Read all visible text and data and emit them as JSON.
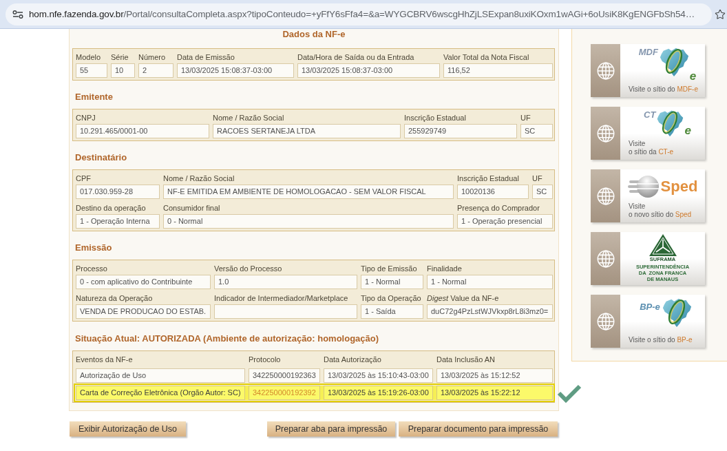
{
  "address_bar": {
    "host": "hom.nfe.fazenda.gov.br",
    "path": "/Portal/consultaCompleta.aspx?tipoConteudo=+yFfY6sFfa4=&a=WYGCBRV6wscgHhZjLSExpan8uxiKOxm1wAGi+6oUsiK8KgENGFbSh54…"
  },
  "title": "Dados da NF-e",
  "dados": [
    [
      {
        "label": "Modelo",
        "value": "55"
      },
      {
        "label": "Série",
        "value": "10"
      },
      {
        "label": "Número",
        "value": "2"
      },
      {
        "label": "Data de Emissão",
        "value": "13/03/2025 15:08:37-03:00"
      },
      {
        "label": "Data/Hora de Saída ou da Entrada",
        "value": "13/03/2025 15:08:37-03:00"
      },
      {
        "label": "Valor Total da Nota Fiscal",
        "value": "116,52"
      }
    ]
  ],
  "sections": [
    {
      "heading": "Emitente",
      "rows": [
        [
          {
            "label": "CNPJ",
            "value": "10.291.465/0001-00"
          },
          {
            "label": "Nome / Razão Social",
            "value": "RACOES SERTANEJA LTDA"
          },
          {
            "label": "Inscrição Estadual",
            "value": "255929749"
          },
          {
            "label": "UF",
            "value": "SC"
          }
        ]
      ]
    },
    {
      "heading": "Destinatário",
      "rows": [
        [
          {
            "label": "CPF",
            "value": "017.030.959-28"
          },
          {
            "label": "Nome / Razão Social",
            "value": "NF-E EMITIDA EM AMBIENTE DE HOMOLOGACAO - SEM VALOR FISCAL"
          },
          {
            "label": "Inscrição Estadual",
            "value": "10020136"
          },
          {
            "label": "UF",
            "value": "SC"
          }
        ],
        [
          {
            "label": "Destino da operação",
            "value": "1 - Operação Interna"
          },
          {
            "label": "Consumidor final",
            "value": "0 - Normal"
          },
          {
            "label": "Presença do Comprador",
            "value": "1 - Operação presencial"
          }
        ]
      ]
    },
    {
      "heading": "Emissão",
      "rows": [
        [
          {
            "label": "Processo",
            "value": "0 - com aplicativo do Contribuinte"
          },
          {
            "label": "Versão do Processo",
            "value": "1.0"
          },
          {
            "label": "Tipo de Emissão",
            "value": "1 - Normal"
          },
          {
            "label": "Finalidade",
            "value": "1 - Normal"
          }
        ],
        [
          {
            "label": "Natureza da Operação",
            "value": "VENDA DE PRODUCAO DO ESTAB."
          },
          {
            "label": "Indicador de Intermediador/Marketplace"
          },
          {
            "label": "Tipo da Operação",
            "value": "1 - Saída"
          },
          {
            "label": "*Digest* Value da NF-e",
            "value": "duC72g4PzLstWJVkxp8rL8i3mz0="
          }
        ]
      ]
    }
  ],
  "situacao": {
    "heading": "Situação Atual: AUTORIZADA (Ambiente de autorização: homologação)",
    "columns": [
      "Eventos da NF-e",
      "Protocolo",
      "Data Autorização",
      "Data Inclusão AN"
    ],
    "rows": [
      {
        "cells": [
          "Autorização de Uso",
          "342250000192363",
          "13/03/2025 às 15:10:43-03:00",
          "13/03/2025 às 15:12:52"
        ],
        "selected": false
      },
      {
        "cells": [
          "Carta de Correção Eletrônica (Orgão Autor: SC)",
          "342250000192392",
          "13/03/2025 às 15:19:26-03:00",
          "13/03/2025 às 15:22:12"
        ],
        "selected": true
      }
    ]
  },
  "buttons": [
    "Exibir Autorização de Uso",
    "Preparar aba para impressão",
    "Preparar documento para impressão"
  ],
  "banners": [
    {
      "kind": "mdfe",
      "logo_text": [
        "MDF",
        "e"
      ],
      "caption": [
        {
          "text": "Visite o sítio do",
          "highlight": "MDF-e"
        }
      ]
    },
    {
      "kind": "cte",
      "logo_text": [
        "CT",
        "e"
      ],
      "caption": [
        {
          "text": "Visite"
        },
        {
          "text": "o sítio da",
          "highlight": "CT-e"
        }
      ]
    },
    {
      "kind": "sped",
      "logo_text": [
        "Sped"
      ],
      "caption": [
        {
          "text": "Visite"
        },
        {
          "text": "o novo sítio do",
          "highlight": "Sped"
        }
      ]
    },
    {
      "kind": "suframa",
      "logo_text": [
        "SUFRAMA"
      ],
      "caption": [
        {
          "text": "SUPERINTENDÊNCIA"
        },
        {
          "text": "DA  ZONA FRANCA"
        },
        {
          "text": "DE MANAUS"
        }
      ]
    },
    {
      "kind": "bpe",
      "logo_text": [
        "BP-e"
      ],
      "caption": [
        {
          "text": "Visite o sítio do",
          "highlight": "BP-e"
        }
      ]
    }
  ]
}
